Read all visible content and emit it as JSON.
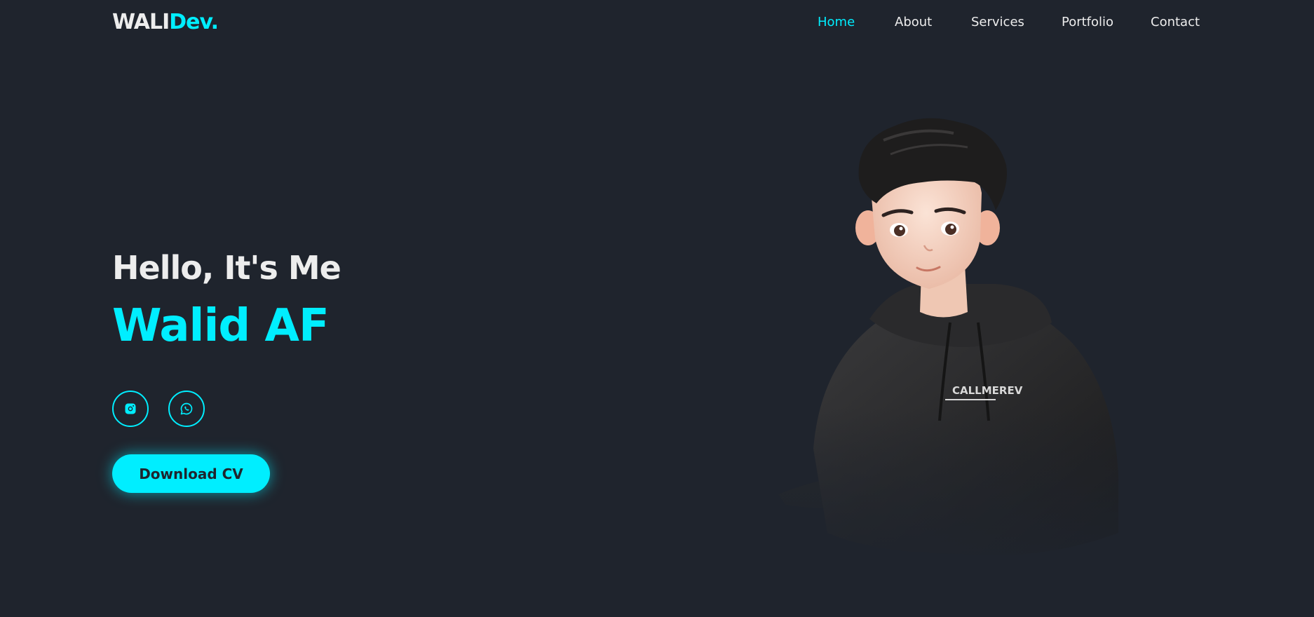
{
  "header": {
    "logo_main": "WALI",
    "logo_accent": "Dev.",
    "nav": [
      {
        "label": "Home",
        "active": true
      },
      {
        "label": "About",
        "active": false
      },
      {
        "label": "Services",
        "active": false
      },
      {
        "label": "Portfolio",
        "active": false
      },
      {
        "label": "Contact",
        "active": false
      }
    ]
  },
  "hero": {
    "greeting": "Hello, It's Me",
    "name": "Walid AF",
    "socials": [
      {
        "icon": "instagram-icon"
      },
      {
        "icon": "whatsapp-icon"
      }
    ],
    "cta_label": "Download CV",
    "hoodie_text": "CALLMEREV"
  },
  "colors": {
    "background": "#1f242d",
    "accent": "#00eeff",
    "text": "#ededed"
  }
}
